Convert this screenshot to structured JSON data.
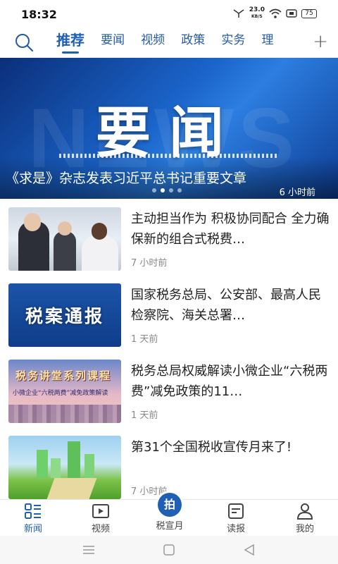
{
  "status_bar": {
    "time": "18:32",
    "net_speed": "23.0",
    "net_unit": "KB/S",
    "battery": "75"
  },
  "tabs": [
    {
      "label": "推荐",
      "active": true
    },
    {
      "label": "要闻",
      "active": false
    },
    {
      "label": "视频",
      "active": false
    },
    {
      "label": "政策",
      "active": false
    },
    {
      "label": "实务",
      "active": false
    },
    {
      "label": "理",
      "active": false
    }
  ],
  "icons": {
    "search": "search-icon",
    "add_channel": "plus-icon"
  },
  "banner": {
    "image_text": "要闻",
    "caption": "《求是》杂志发表习近平总书记重要文章",
    "time": "6 小时前",
    "page_count": 4,
    "current_page": 2
  },
  "news": [
    {
      "title": "主动担当作为 积极协同配合 全力确保新的组合式税费…",
      "time": "7 小时前"
    },
    {
      "title": "国家税务总局、公安部、最高人民检察院、海关总署…",
      "time": "1 天前",
      "thumb_text": "税案通报"
    },
    {
      "title": "税务总局权威解读小微企业“六税两费”减免政策的11…",
      "time": "1 天前",
      "thumb_text": "税务讲堂系列课程",
      "thumb_subtext": "小微企业“六税两费”减免政策解读"
    },
    {
      "title": "第31个全国税收宣传月来了!",
      "time": "7 小时前"
    }
  ],
  "bottom_nav": {
    "items": [
      {
        "label": "新闻",
        "icon": "news-list-icon",
        "active": true
      },
      {
        "label": "视频",
        "icon": "video-play-icon",
        "active": false
      },
      {
        "label": "读报",
        "icon": "newspaper-icon",
        "active": false
      },
      {
        "label": "我的",
        "icon": "person-icon",
        "active": false
      }
    ],
    "center": {
      "badge": "拍",
      "label": "税宣月"
    }
  },
  "colors": {
    "accent": "#1f5fb4",
    "tab_text": "#245aa8",
    "meta_text": "#888888"
  }
}
